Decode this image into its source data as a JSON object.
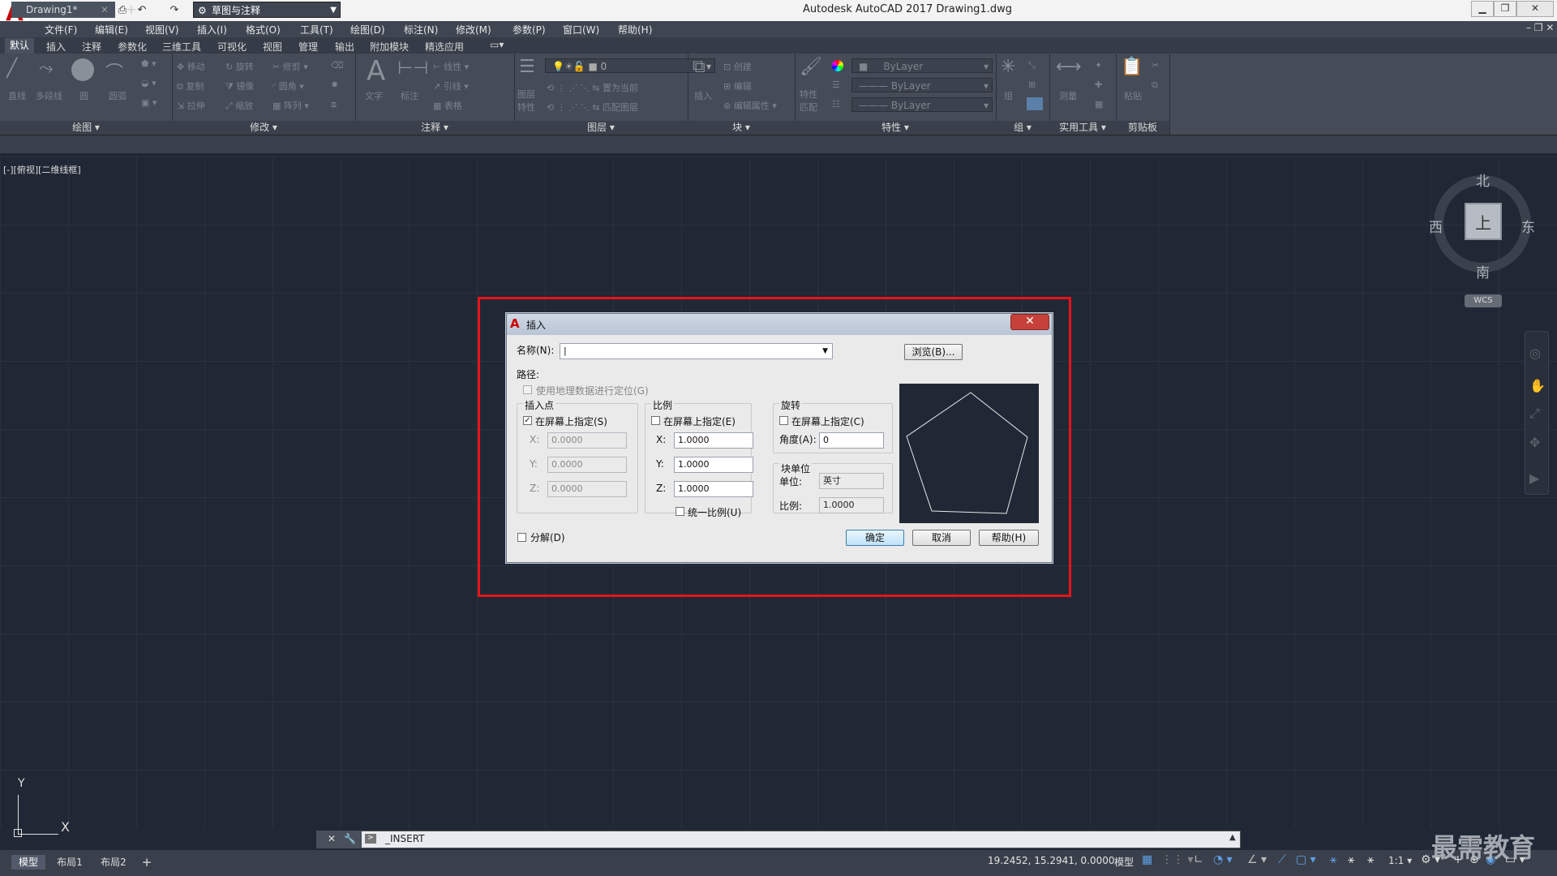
{
  "titlebar": {
    "app_logo": "A",
    "title": "Autodesk AutoCAD 2017    Drawing1.dwg",
    "workspace": "草图与注释"
  },
  "menubar": [
    "文件(F)",
    "编辑(E)",
    "视图(V)",
    "插入(I)",
    "格式(O)",
    "工具(T)",
    "绘图(D)",
    "标注(N)",
    "修改(M)",
    "参数(P)",
    "窗口(W)",
    "帮助(H)"
  ],
  "ribbon_tabs": [
    "默认",
    "插入",
    "注释",
    "参数化",
    "三维工具",
    "可视化",
    "视图",
    "管理",
    "输出",
    "附加模块",
    "精选应用"
  ],
  "ribbon_groups": {
    "draw": "绘图",
    "modify": "修改",
    "annotation": "注释",
    "layers": "图层",
    "block": "块",
    "properties": "特性",
    "groups": "组",
    "utilities": "实用工具",
    "clipboard": "剪贴板"
  },
  "ribbon_buttons": {
    "line": "直线",
    "polyline": "多段线",
    "circle": "圆",
    "arc": "圆弧",
    "move": "移动",
    "rotate": "旋转",
    "trim": "修剪",
    "copy": "复制",
    "mirror": "镜像",
    "fillet": "圆角",
    "stretch": "拉伸",
    "scale": "缩放",
    "array": "阵列",
    "text": "文字",
    "dimension": "标注",
    "linear": "线性",
    "leader": "引线",
    "table": "表格",
    "layer_props": "图层特性",
    "layer_current": "0",
    "set_current": "置为当前",
    "match_layer": "匹配图层",
    "insert": "插入",
    "create": "创建",
    "edit": "编辑",
    "edit_attr": "编辑属性",
    "match_props": "特性匹配",
    "bylayer": "ByLayer",
    "group": "组",
    "measure": "测量",
    "paste": "粘贴"
  },
  "doc_tab": "Drawing1*",
  "viewport_label": "[-][俯视][二维线框]",
  "viewcube": {
    "north": "北",
    "south": "南",
    "east": "东",
    "west": "西",
    "face": "上",
    "wcs": "WCS"
  },
  "ucs": {
    "x": "X",
    "y": "Y"
  },
  "command_line": "_INSERT",
  "layout_tabs": [
    "模型",
    "布局1",
    "布局2"
  ],
  "statusbar": {
    "coords": "19.2452, 15.2941, 0.0000",
    "model": "模型",
    "scale": "1:1"
  },
  "watermark": "最需教育",
  "dialog": {
    "title": "插入",
    "name_label": "名称(N):",
    "name_value": "|",
    "browse": "浏览(B)...",
    "path_label": "路径:",
    "geo_label": "使用地理数据进行定位(G)",
    "insertion": {
      "title": "插入点",
      "specify": "在屏幕上指定(S)",
      "x_label": "X:",
      "x": "0.0000",
      "y_label": "Y:",
      "y": "0.0000",
      "z_label": "Z:",
      "z": "0.0000"
    },
    "scale": {
      "title": "比例",
      "specify": "在屏幕上指定(E)",
      "x_label": "X:",
      "x": "1.0000",
      "y_label": "Y:",
      "y": "1.0000",
      "z_label": "Z:",
      "z": "1.0000",
      "uniform": "统一比例(U)"
    },
    "rotation": {
      "title": "旋转",
      "specify": "在屏幕上指定(C)",
      "angle_label": "角度(A):",
      "angle": "0"
    },
    "block_unit": {
      "title": "块单位",
      "unit_label": "单位:",
      "unit": "英寸",
      "factor_label": "比例:",
      "factor": "1.0000"
    },
    "explode": "分解(D)",
    "ok": "确定",
    "cancel": "取消",
    "help": "帮助(H)"
  }
}
